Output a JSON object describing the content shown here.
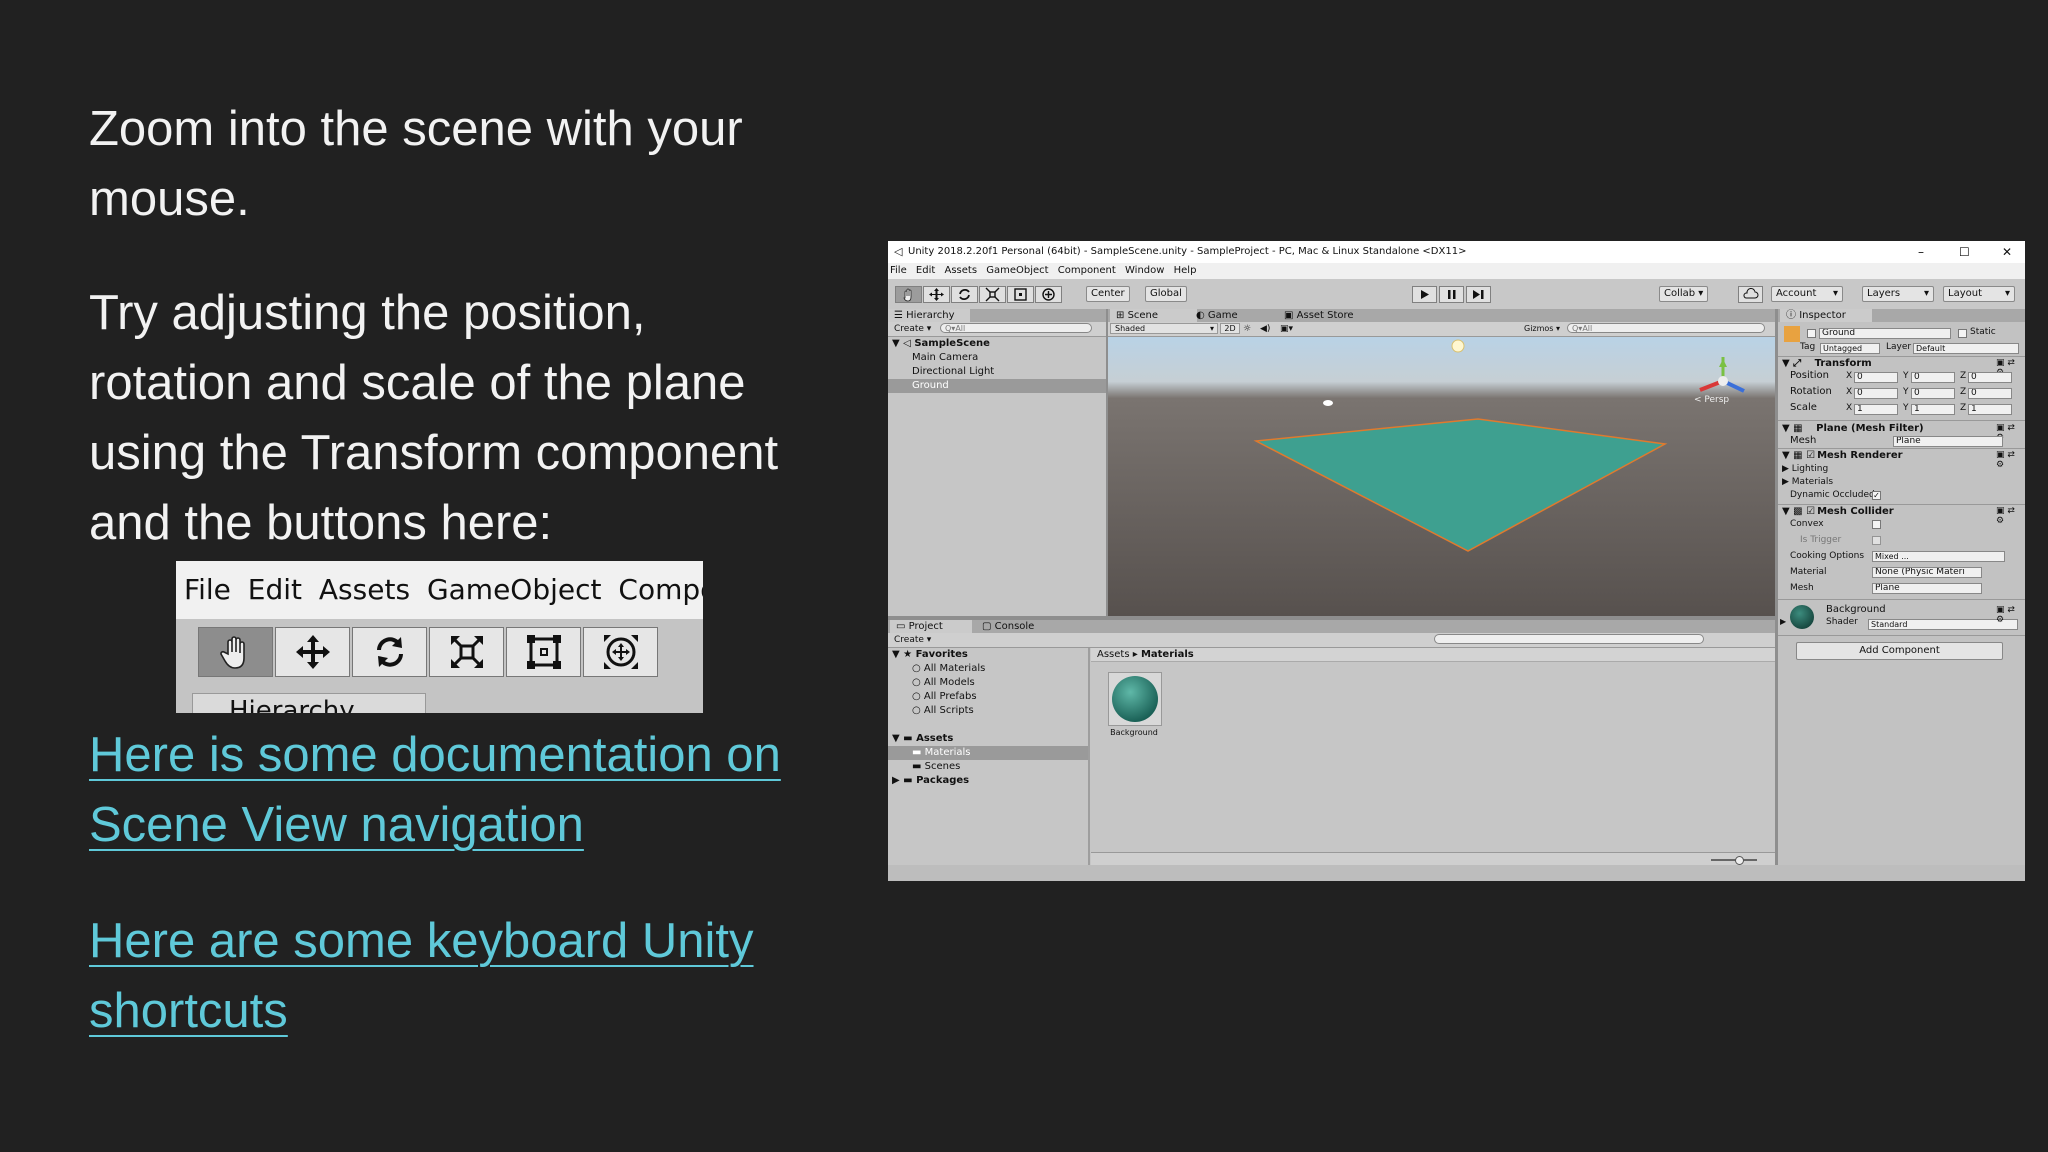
{
  "slide": {
    "para1": [
      "Zoom into the scene with your",
      "mouse."
    ],
    "para2": [
      "Try adjusting the position,",
      "rotation and scale of the plane",
      "using the Transform component",
      "and the buttons here:"
    ],
    "link1": [
      "Here is some documentation on",
      "Scene View navigation"
    ],
    "link2": [
      "Here are some keyboard Unity",
      "shortcuts"
    ]
  },
  "toolbar_crop": {
    "menu": [
      "File",
      "Edit",
      "Assets",
      "GameObject",
      "Componer"
    ],
    "tools": [
      "hand-tool-icon",
      "move-tool-icon",
      "rotate-tool-icon",
      "scale-tool-icon",
      "rect-tool-icon",
      "transform-tool-icon"
    ],
    "hierarchy_tab": "Hierarchy"
  },
  "unity": {
    "title": "Unity 2018.2.20f1 Personal (64bit) - SampleScene.unity - SampleProject - PC, Mac & Linux Standalone <DX11>",
    "window_controls": [
      "–",
      "☐",
      "✕"
    ],
    "menu": [
      "File",
      "Edit",
      "Assets",
      "GameObject",
      "Component",
      "Window",
      "Help"
    ],
    "toolbar": {
      "center": "Center",
      "global": "Global",
      "collab": "Collab ▾",
      "account": "Account",
      "layers": "Layers",
      "layout": "Layout"
    },
    "hierarchy": {
      "tab": "Hierarchy",
      "create": "Create ▾",
      "search": "Q▾All",
      "scene": "SampleScene",
      "items": [
        "Main Camera",
        "Directional Light",
        "Ground"
      ]
    },
    "scene": {
      "tabs": [
        "Scene",
        "Game",
        "Asset Store"
      ],
      "shaded": "Shaded",
      "mode2d": "2D",
      "gizmos": "Gizmos ▾",
      "search": "Q▾All",
      "persp": "< Persp"
    },
    "project": {
      "tabs": [
        "Project",
        "Console"
      ],
      "create": "Create ▾",
      "favorites": "Favorites",
      "fav_items": [
        "All Materials",
        "All Models",
        "All Prefabs",
        "All Scripts"
      ],
      "assets": "Assets",
      "asset_items": [
        "Materials",
        "Scenes"
      ],
      "packages": "Packages",
      "breadcrumb_root": "Assets",
      "breadcrumb_sep": "▸",
      "breadcrumb_current": "Materials",
      "asset_name": "Background"
    },
    "inspector": {
      "tab": "Inspector",
      "object_name": "Ground",
      "static": "Static",
      "tag_label": "Tag",
      "tag_value": "Untagged",
      "layer_label": "Layer",
      "layer_value": "Default",
      "transform": {
        "title": "Transform",
        "rows": [
          {
            "label": "Position",
            "x": "0",
            "y": "0",
            "z": "0"
          },
          {
            "label": "Rotation",
            "x": "0",
            "y": "0",
            "z": "0"
          },
          {
            "label": "Scale",
            "x": "1",
            "y": "1",
            "z": "1"
          }
        ]
      },
      "mesh_filter": {
        "title": "Plane (Mesh Filter)",
        "mesh_label": "Mesh",
        "mesh_value": "Plane"
      },
      "mesh_renderer": {
        "title": "Mesh Renderer",
        "rows": [
          "Lighting",
          "Materials",
          "Dynamic Occluded"
        ]
      },
      "mesh_collider": {
        "title": "Mesh Collider",
        "convex": "Convex",
        "is_trigger": "Is Trigger",
        "cooking_label": "Cooking Options",
        "cooking_value": "Mixed ...",
        "material_label": "Material",
        "material_value": "None (Physic Materi",
        "mesh_label": "Mesh",
        "mesh_value": "Plane"
      },
      "material": {
        "name": "Background",
        "shader_label": "Shader",
        "shader_value": "Standard"
      },
      "add_component": "Add Component"
    }
  }
}
